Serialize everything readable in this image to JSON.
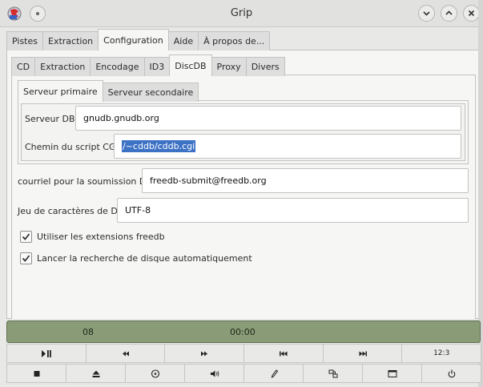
{
  "window": {
    "title": "Grip"
  },
  "main_tabs": [
    "Pistes",
    "Extraction",
    "Configuration",
    "Aide",
    "À propos de..."
  ],
  "config_tabs": [
    "CD",
    "Extraction",
    "Encodage",
    "ID3",
    "DiscDB",
    "Proxy",
    "Divers"
  ],
  "server_tabs": [
    "Serveur primaire",
    "Serveur secondaire"
  ],
  "primary_server": {
    "db_label": "Serveur DB",
    "db_value": "gnudb.gnudb.org",
    "cgi_label": "Chemin du script CGI",
    "cgi_value": "/~cddb/cddb.cgi"
  },
  "submit_email": {
    "label": "courriel pour la soumission DB",
    "value": "freedb-submit@freedb.org"
  },
  "charset": {
    "label": "Jeu de caractères de DB",
    "value": "UTF-8"
  },
  "checkboxes": [
    {
      "label": "Utiliser les extensions freedb",
      "checked": true
    },
    {
      "label": "Lancer la recherche de disque automatiquement",
      "checked": true
    }
  ],
  "status": {
    "track": "08",
    "time": "00:00",
    "bg_color": "#899c77"
  },
  "controls_row1": [
    "play-pause-icon",
    "rewind-icon",
    "fast-forward-icon",
    "previous-track-icon",
    "next-track-icon",
    "track-numbers-icon"
  ],
  "controls_row1_text": {
    "track_numbers": "12:3"
  },
  "controls_row2": [
    "stop-icon",
    "eject-icon",
    "scan-disc-icon",
    "volume-icon",
    "edit-icon",
    "shuffle-icon",
    "window-icon",
    "power-icon"
  ]
}
